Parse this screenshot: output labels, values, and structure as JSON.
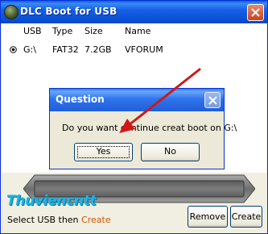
{
  "window": {
    "title": "DLC Boot for USB"
  },
  "list": {
    "columns": [
      "USB",
      "Type",
      "Size",
      "Name"
    ],
    "rows": [
      {
        "usb": "G:\\",
        "type": "FAT32",
        "size": "7.2GB",
        "name": "VFORUM",
        "selected": true
      }
    ]
  },
  "dialog": {
    "title": "Question",
    "message": "Do you want continue creat boot on G:\\",
    "yes_label": "Yes",
    "no_label": "No"
  },
  "footer": {
    "watermark": "Thuviencntt",
    "hint_prefix": "Select USB then ",
    "hint_action": "Create",
    "remove_label": "Remove",
    "create_label": "Create"
  },
  "colors": {
    "accent": "#d05500",
    "arrow": "#d01818",
    "titlebar": "#1560e8"
  },
  "icons": {
    "app": "dlc-app-icon",
    "close": "close-icon",
    "radio": "radio-selected-icon"
  }
}
